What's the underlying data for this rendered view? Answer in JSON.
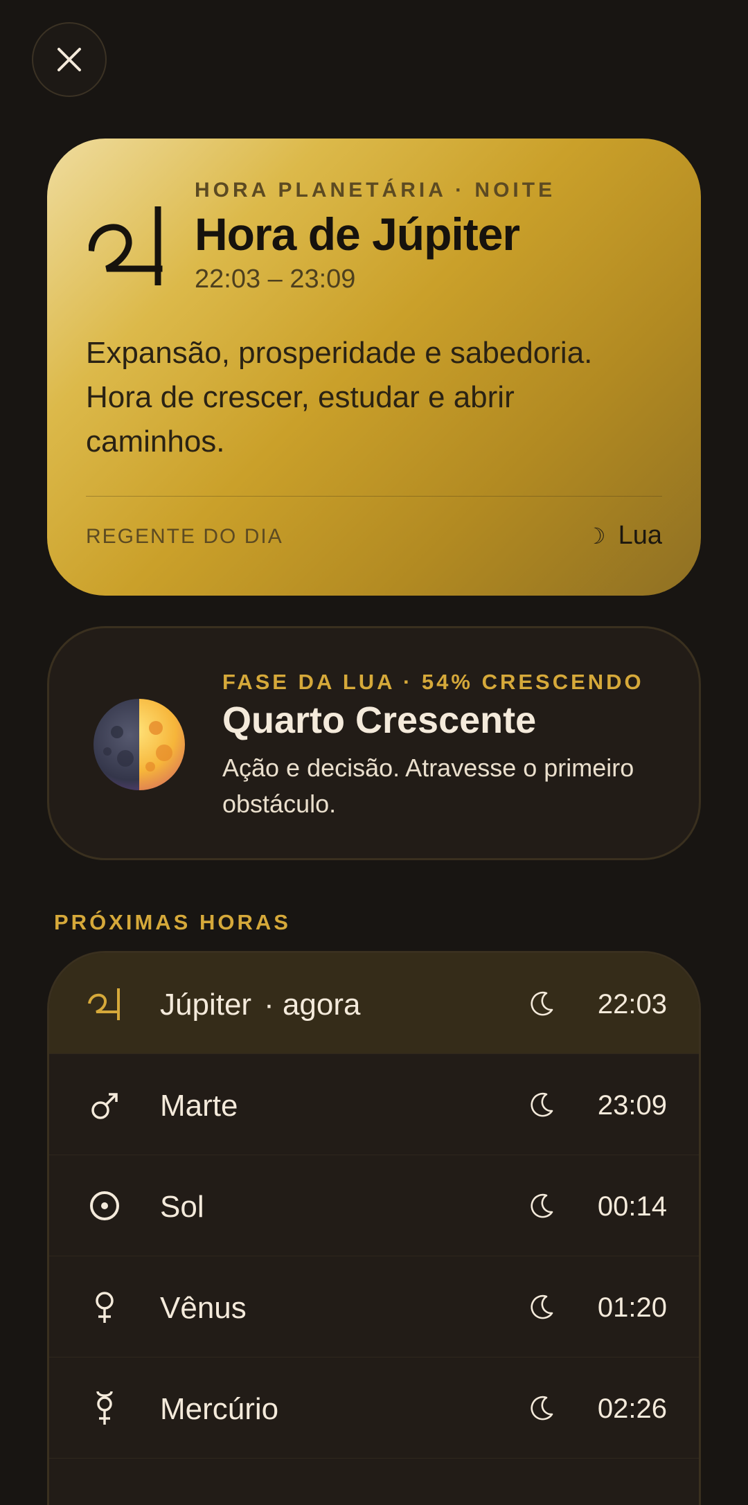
{
  "close_icon": "close-icon",
  "hero": {
    "eyebrow": "HORA PLANETÁRIA · NOITE",
    "title": "Hora de Júpiter",
    "time": "22:03 – 23:09",
    "desc": "Expansão, prosperidade e sabedoria. Hora de crescer, estudar e abrir caminhos.",
    "footer_label": "REGENTE DO DIA",
    "footer_glyph": "☽",
    "footer_value": "Lua",
    "glyph_icon": "jupiter-glyph-icon"
  },
  "moon": {
    "eyebrow": "FASE DA LUA · 54% CRESCENDO",
    "title": "Quarto Crescente",
    "desc": "Ação e decisão. Atravesse o primeiro obstáculo.",
    "icon": "first-quarter-moon-icon",
    "illumination_percent": 54
  },
  "section_label": "PRÓXIMAS HORAS",
  "hours": [
    {
      "name": "Júpiter",
      "now_label": "· agora",
      "time": "22:03",
      "icon": "jupiter-icon",
      "period_icon": "night-moon-icon",
      "current": true
    },
    {
      "name": "Marte",
      "time": "23:09",
      "icon": "mars-icon",
      "period_icon": "night-moon-icon"
    },
    {
      "name": "Sol",
      "time": "00:14",
      "icon": "sun-icon",
      "period_icon": "night-moon-icon"
    },
    {
      "name": "Vênus",
      "time": "01:20",
      "icon": "venus-icon",
      "period_icon": "night-moon-icon"
    },
    {
      "name": "Mercúrio",
      "time": "02:26",
      "icon": "mercury-icon",
      "period_icon": "night-moon-icon"
    }
  ],
  "colors": {
    "background": "#181512",
    "accent_gold": "#d6a93a",
    "card_dark": "#221c17",
    "current_row": "#352c19"
  }
}
